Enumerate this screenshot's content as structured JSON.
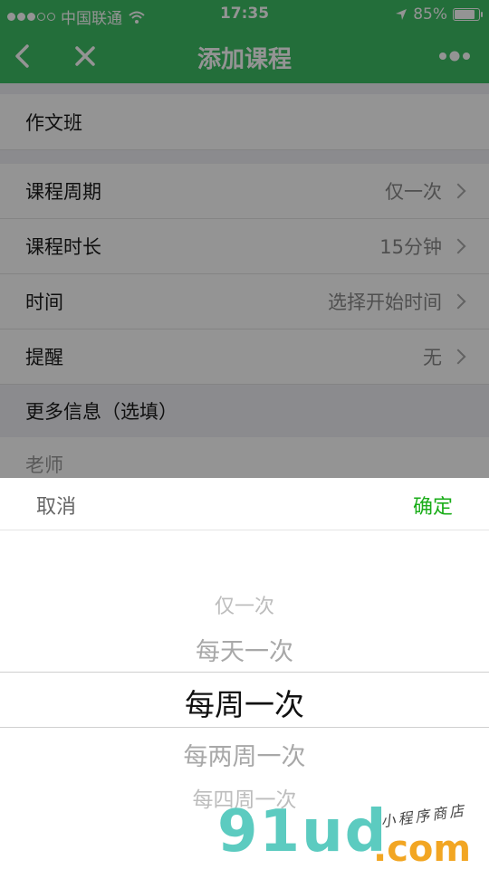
{
  "status_bar": {
    "carrier": "中国联通",
    "time": "17:35",
    "battery": "85%",
    "battery_level": 0.85,
    "signal_bars_filled": 3,
    "signal_bars_total": 5
  },
  "nav": {
    "title": "添加课程",
    "color": "#3dbd64"
  },
  "form": {
    "course_name": "作文班",
    "rows": [
      {
        "label": "课程周期",
        "value": "仅一次"
      },
      {
        "label": "课程时长",
        "value": "15分钟"
      },
      {
        "label": "时间",
        "value": "选择开始时间"
      },
      {
        "label": "提醒",
        "value": "无"
      }
    ],
    "more_info_header": "更多信息（选填）",
    "teacher_label": "老师"
  },
  "picker": {
    "cancel_label": "取消",
    "confirm_label": "确定",
    "confirm_color": "#1aad19",
    "options": [
      "仅一次",
      "每天一次",
      "每周一次",
      "每两周一次",
      "每四周一次"
    ],
    "selected_index": 2
  },
  "watermark": {
    "brand": "91ud",
    "tld": ".com",
    "tagline": "小程序商店"
  }
}
